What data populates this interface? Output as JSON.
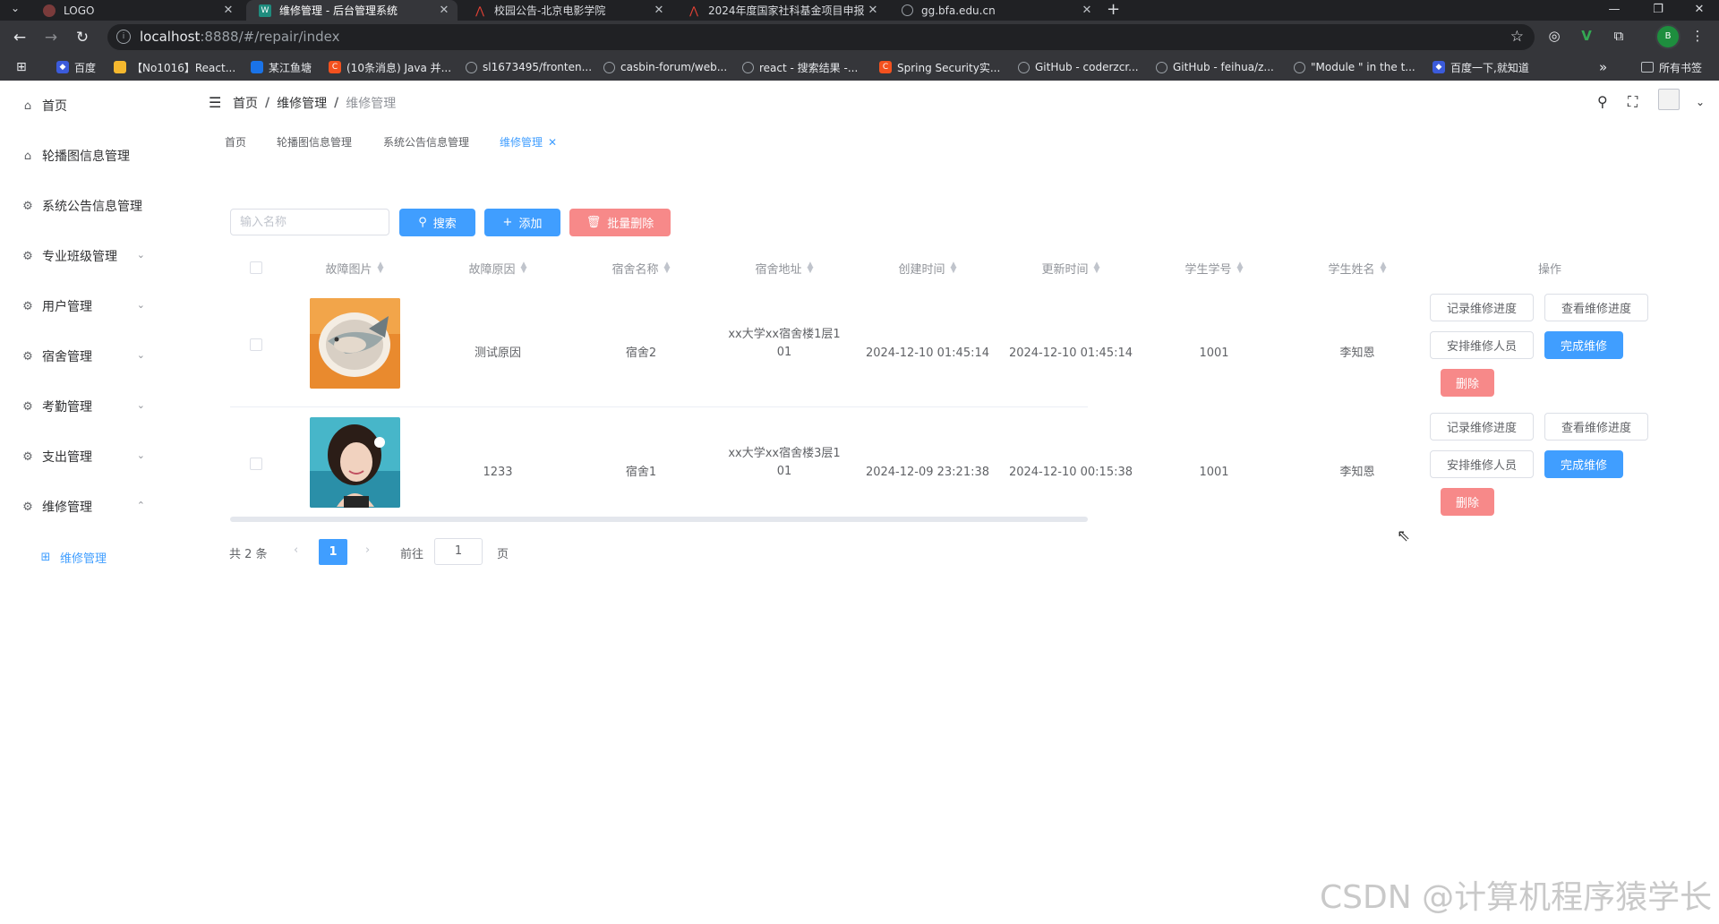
{
  "browser": {
    "tab_menu": "⌄",
    "tabs": [
      {
        "title": "LOGO",
        "icon": "logo-icon"
      },
      {
        "title": "维修管理 - 后台管理系统",
        "icon": "site-icon"
      },
      {
        "title": "校园公告-北京电影学院",
        "icon": "bfa-icon"
      },
      {
        "title": "2024年度国家社科基金项目申报",
        "icon": "bfa-icon"
      },
      {
        "title": "gg.bfa.edu.cn",
        "icon": "globe-icon"
      }
    ],
    "url_host": "localhost",
    "url_rest": ":8888/#/repair/index",
    "bookmarks": [
      "百度",
      "【No1016】React...",
      "某江鱼塘",
      "(10条消息) Java 并...",
      "sl1673495/fronten...",
      "casbin-forum/web...",
      "react - 搜索结果 -...",
      "Spring Security实...",
      "GitHub - coderzcr...",
      "GitHub - feihua/z...",
      "\"Module \" in the t...",
      "百度一下,就知道"
    ],
    "bookmarks_more": "»",
    "all_bookmarks": "所有书签",
    "profile_initial": "B"
  },
  "sidebar": {
    "items": [
      {
        "label": "首页",
        "icon": "home-icon"
      },
      {
        "label": "轮播图信息管理",
        "icon": "home-icon"
      },
      {
        "label": "系统公告信息管理",
        "icon": "setting-icon"
      },
      {
        "label": "专业班级管理",
        "icon": "setting-icon"
      },
      {
        "label": "用户管理",
        "icon": "setting-icon"
      },
      {
        "label": "宿舍管理",
        "icon": "setting-icon"
      },
      {
        "label": "考勤管理",
        "icon": "setting-icon"
      },
      {
        "label": "支出管理",
        "icon": "setting-icon"
      },
      {
        "label": "维修管理",
        "icon": "setting-icon"
      }
    ],
    "sub_item": "维修管理"
  },
  "breadcrumb": [
    "首页",
    "维修管理",
    "维修管理"
  ],
  "tags": [
    "首页",
    "轮播图信息管理",
    "系统公告信息管理",
    "维修管理"
  ],
  "toolbar": {
    "search_placeholder": "输入名称",
    "search_label": "搜索",
    "add_label": "添加",
    "batch_delete_label": "批量删除"
  },
  "table": {
    "columns": [
      "故障图片",
      "故障原因",
      "宿舍名称",
      "宿舍地址",
      "创建时间",
      "更新时间",
      "学生学号",
      "学生姓名",
      "操作"
    ],
    "rows": [
      {
        "image": "fish-dish-photo",
        "reason": "测试原因",
        "dorm_name": "宿舍2",
        "dorm_addr_1": "xx大学xx宿舍楼1层1",
        "dorm_addr_2": "01",
        "created": "2024-12-10 01:45:14",
        "updated": "2024-12-10 01:45:14",
        "student_no": "1001",
        "student_name": "李知恩"
      },
      {
        "image": "portrait-photo",
        "reason": "1233",
        "dorm_name": "宿舍1",
        "dorm_addr_1": "xx大学xx宿舍楼3层1",
        "dorm_addr_2": "01",
        "created": "2024-12-09 23:21:38",
        "updated": "2024-12-10 00:15:38",
        "student_no": "1001",
        "student_name": "李知恩"
      }
    ],
    "actions": {
      "record": "记录维修进度",
      "view": "查看维修进度",
      "assign": "安排维修人员",
      "complete": "完成维修",
      "delete": "删除"
    }
  },
  "pagination": {
    "total": "共 2 条",
    "current": "1",
    "goto": "前往",
    "page_input": "1",
    "page_suffix": "页"
  },
  "watermark": "CSDN @计算机程序猿学长",
  "colors": {
    "primary": "#409eff",
    "danger": "#f78989",
    "text": "#303133"
  }
}
